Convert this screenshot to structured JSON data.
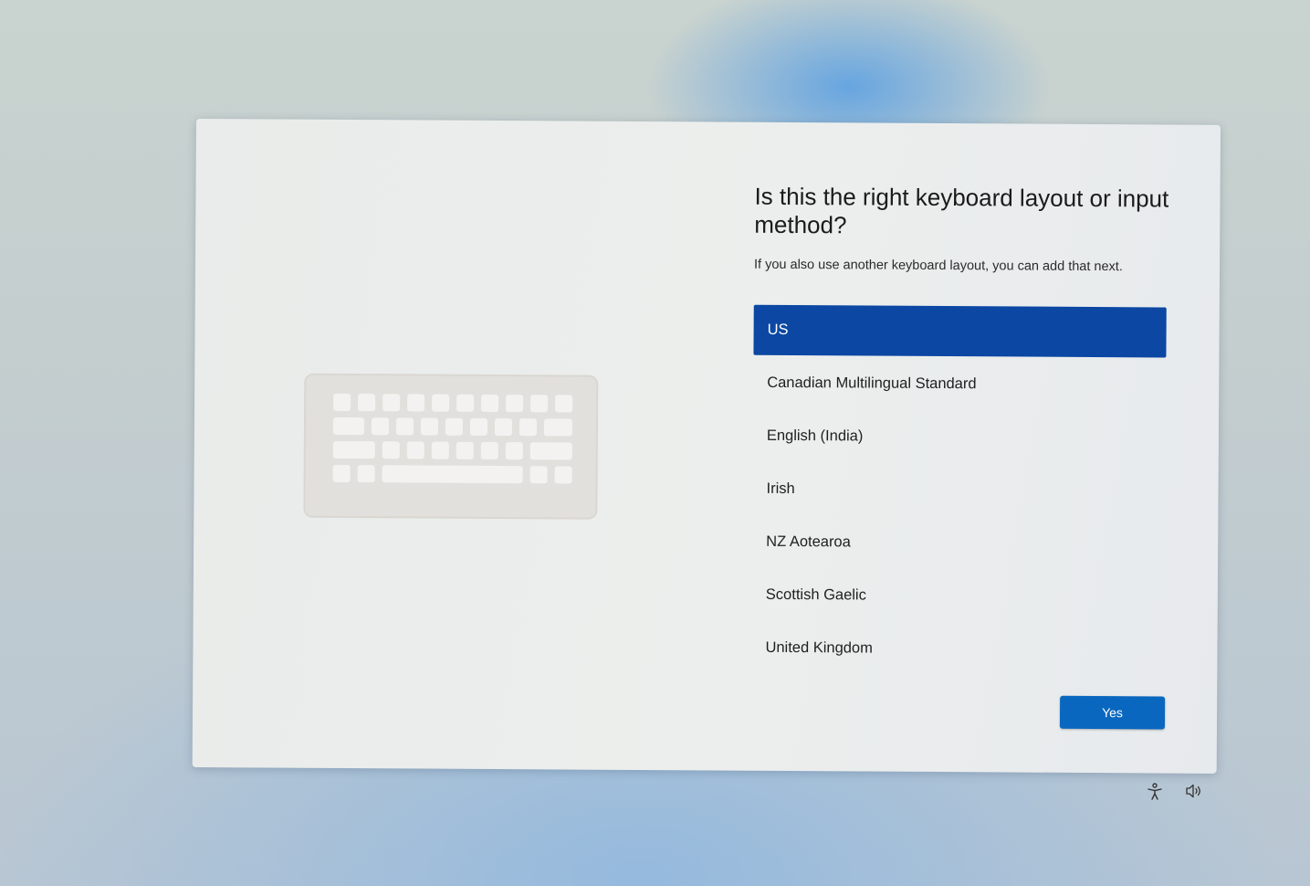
{
  "dialog": {
    "title": "Is this the right keyboard layout or input method?",
    "subtitle": "If you also use another keyboard layout, you can add that next.",
    "layouts": [
      {
        "label": "US",
        "selected": true
      },
      {
        "label": "Canadian Multilingual Standard",
        "selected": false
      },
      {
        "label": "English (India)",
        "selected": false
      },
      {
        "label": "Irish",
        "selected": false
      },
      {
        "label": "NZ Aotearoa",
        "selected": false
      },
      {
        "label": "Scottish Gaelic",
        "selected": false
      },
      {
        "label": "United Kingdom",
        "selected": false
      }
    ],
    "yes_label": "Yes",
    "illustration_icon": "keyboard-icon"
  },
  "taskbar": {
    "accessibility_icon": "accessibility-icon",
    "volume_icon": "volume-icon"
  },
  "colors": {
    "selected_item": "#0b47a3",
    "primary_button": "#0a67bf",
    "dialog_background": "#eceeed"
  }
}
